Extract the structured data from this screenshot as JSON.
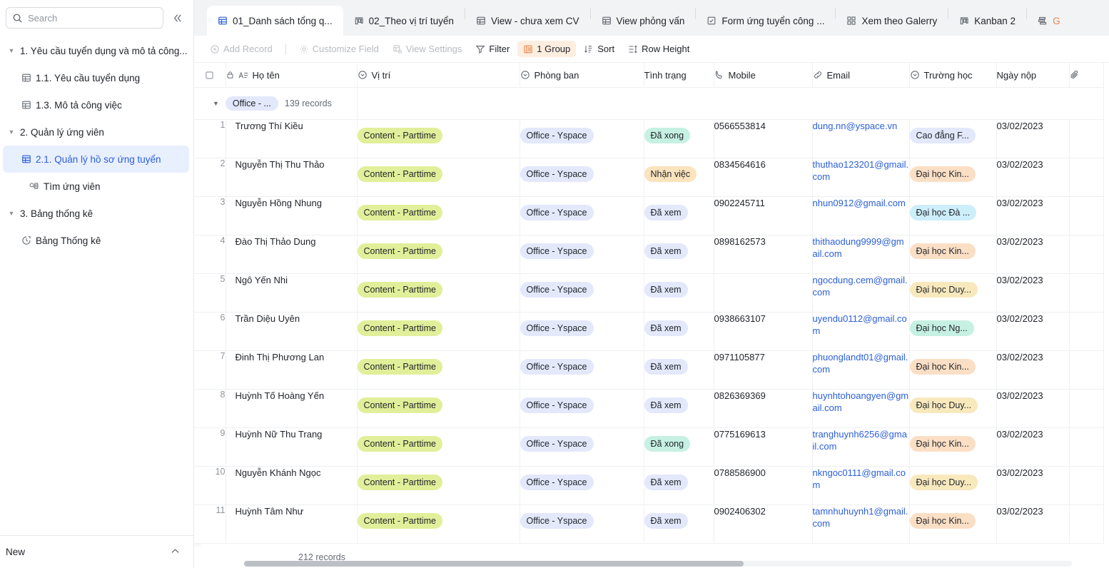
{
  "sidebar": {
    "search": {
      "placeholder": "Search",
      "icon": "search-icon"
    },
    "collapse_label": "«",
    "items": [
      {
        "level": 1,
        "label": "1. Yêu cầu tuyển dụng và mô tả công...",
        "icon": "caret-down-icon",
        "selected": false
      },
      {
        "level": 2,
        "label": "1.1. Yêu cầu tuyển dụng",
        "icon": "table-icon",
        "selected": false
      },
      {
        "level": 2,
        "label": "1.3. Mô tả công việc",
        "icon": "table-icon",
        "selected": false
      },
      {
        "level": 1,
        "label": "2. Quản lý ứng viên",
        "icon": "caret-down-icon",
        "selected": false
      },
      {
        "level": 2,
        "label": "2.1. Quản lý hồ sơ ứng tuyển",
        "icon": "table-icon",
        "selected": true
      },
      {
        "level": 3,
        "label": "Tìm ứng viên",
        "icon": "form-search-icon",
        "selected": false
      },
      {
        "level": 1,
        "label": "3. Bảng thống kê",
        "icon": "caret-down-icon",
        "selected": false
      },
      {
        "level": 2,
        "label": "Bảng Thống kê",
        "icon": "dashboard-clock-icon",
        "selected": false
      }
    ],
    "footer": {
      "label": "New",
      "chevron": "chevron-up-icon"
    }
  },
  "tabs": [
    {
      "label": "01_Danh sách tổng q...",
      "icon": "grid-view-icon",
      "active": true
    },
    {
      "label": "02_Theo vị trí tuyển",
      "icon": "kanban-view-icon",
      "active": false
    },
    {
      "label": "View - chưa xem CV",
      "icon": "grid-view-icon",
      "active": false
    },
    {
      "label": "View phỏng vấn",
      "icon": "grid-view-icon",
      "active": false
    },
    {
      "label": "Form ứng tuyển công ...",
      "icon": "form-view-icon",
      "active": false
    },
    {
      "label": "Xem theo Galerry",
      "icon": "gallery-view-icon",
      "active": false
    },
    {
      "label": "Kanban 2",
      "icon": "kanban-view-icon",
      "active": false
    },
    {
      "label": "G",
      "icon": "gantt-view-icon",
      "active": false
    }
  ],
  "toolbar": {
    "add_record": "Add Record",
    "customize_field": "Customize Field",
    "view_settings": "View Settings",
    "filter": "Filter",
    "group": "1 Group",
    "sort": "Sort",
    "row_height": "Row Height"
  },
  "table": {
    "columns": [
      {
        "key": "chk",
        "label": "",
        "icon": "checkbox-icon",
        "cls": "c-chk"
      },
      {
        "key": "name",
        "label": "Họ tên",
        "icon": "text-field-icon",
        "lock": "lock-icon",
        "cls": "c-name"
      },
      {
        "key": "pos",
        "label": "Vị trí",
        "icon": "select-field-icon",
        "cls": "c-pos"
      },
      {
        "key": "dept",
        "label": "Phòng ban",
        "icon": "select-field-icon",
        "cls": "c-dept"
      },
      {
        "key": "stat",
        "label": "Tình trạng",
        "icon": "",
        "cls": "c-stat"
      },
      {
        "key": "mob",
        "label": "Mobile",
        "icon": "phone-icon",
        "cls": "c-mob"
      },
      {
        "key": "mail",
        "label": "Email",
        "icon": "link-icon",
        "cls": "c-mail"
      },
      {
        "key": "sch",
        "label": "Trường học",
        "icon": "select-field-icon",
        "cls": "c-sch"
      },
      {
        "key": "date",
        "label": "Ngày nộp",
        "icon": "",
        "cls": "c-date"
      },
      {
        "key": "att",
        "label": "",
        "icon": "attachment-icon",
        "cls": "c-att"
      }
    ],
    "group": {
      "tag": "Office - ...",
      "count": "139 records"
    },
    "rows": [
      {
        "n": "1",
        "name": "Trương Thí Kiều",
        "pos": "Content  - Parttime",
        "dept": "Office - Yspace",
        "stat": "Đã xong",
        "mob": "0566553814",
        "mail": "dung.nn@yspace.vn",
        "sch": "Cao đẳng F...",
        "date": "03/02/2023"
      },
      {
        "n": "2",
        "name": "Nguyễn Thị Thu Thảo",
        "pos": "Content  - Parttime",
        "dept": "Office - Yspace",
        "stat": "Nhận việc",
        "mob": "0834564616",
        "mail": "thuthao123201@gmail.com",
        "sch": "Đại học Kin...",
        "date": "03/02/2023"
      },
      {
        "n": "3",
        "name": "Nguyễn Hồng Nhung",
        "pos": "Content  - Parttime",
        "dept": "Office - Yspace",
        "stat": "Đã xem",
        "mob": "0902245711",
        "mail": "nhun0912@gmail.com",
        "sch": "Đại học Đà ...",
        "date": "03/02/2023"
      },
      {
        "n": "4",
        "name": "Đào Thị Thảo Dung",
        "pos": "Content  - Parttime",
        "dept": "Office - Yspace",
        "stat": "Đã xem",
        "mob": "0898162573",
        "mail": "thithaodung9999@gmail.com",
        "sch": "Đại học Kin...",
        "date": "03/02/2023"
      },
      {
        "n": "5",
        "name": "Ngô Yến Nhi",
        "pos": "Content  - Parttime",
        "dept": "Office - Yspace",
        "stat": "Đã xem",
        "mob": "",
        "mail": "ngocdung.cem@gmail.com",
        "sch": "Đại học Duy...",
        "date": "03/02/2023"
      },
      {
        "n": "6",
        "name": "Trần Diệu Uyên",
        "pos": "Content  - Parttime",
        "dept": "Office - Yspace",
        "stat": "Đã xem",
        "mob": "0938663107",
        "mail": "uyendu0112@gmail.com",
        "sch": "Đại học Ng...",
        "date": "03/02/2023"
      },
      {
        "n": "7",
        "name": "Đinh Thị Phương Lan",
        "pos": "Content  - Parttime",
        "dept": "Office - Yspace",
        "stat": "Đã xem",
        "mob": "0971105877",
        "mail": "phuonglandt01@gmail.com",
        "sch": "Đại học Kin...",
        "date": "03/02/2023"
      },
      {
        "n": "8",
        "name": "Huỳnh Tố Hoàng Yến",
        "pos": "Content  - Parttime",
        "dept": "Office - Yspace",
        "stat": "Đã xem",
        "mob": "0826369369",
        "mail": "huynhtohoangyen@gmail.com",
        "sch": "Đại học Duy...",
        "date": "03/02/2023"
      },
      {
        "n": "9",
        "name": "Huỳnh Nữ Thu Trang",
        "pos": "Content  - Parttime",
        "dept": "Office - Yspace",
        "stat": "Đã xong",
        "mob": "0775169613",
        "mail": "tranghuynh6256@gmail.com",
        "sch": "Đại học Kin...",
        "date": "03/02/2023"
      },
      {
        "n": "10",
        "name": "Nguyễn Khánh Ngọc",
        "pos": "Content  - Parttime",
        "dept": "Office - Yspace",
        "stat": "Đã xem",
        "mob": "0788586900",
        "mail": "nkngoc0111@gmail.com",
        "sch": "Đại học Duy...",
        "date": "03/02/2023"
      },
      {
        "n": "11",
        "name": "Huỳnh Tâm Như",
        "pos": "Content  - Parttime",
        "dept": "Office - Yspace",
        "stat": "Đã xem",
        "mob": "0902406302",
        "mail": "tamnhuhuynh1@gmail.com",
        "sch": "Đại học Kin...",
        "date": "03/02/2023"
      }
    ],
    "footer_count": "212 records"
  },
  "colors": {
    "tag_position": "#e1ef9a",
    "tag_dept": "#e3e8fb",
    "status_done": "#c6f1e2",
    "status_hired": "#fbe3bd",
    "status_viewed": "#e3e8fb",
    "school_blue": "#e3e8fb",
    "school_orange": "#fbdfc5",
    "school_cyan": "#cdeefb",
    "school_yellow": "#f8e9bd",
    "school_mint": "#c6f1e2",
    "accent": "#2b5fd9",
    "group_btn_bg": "#fdeee0"
  }
}
